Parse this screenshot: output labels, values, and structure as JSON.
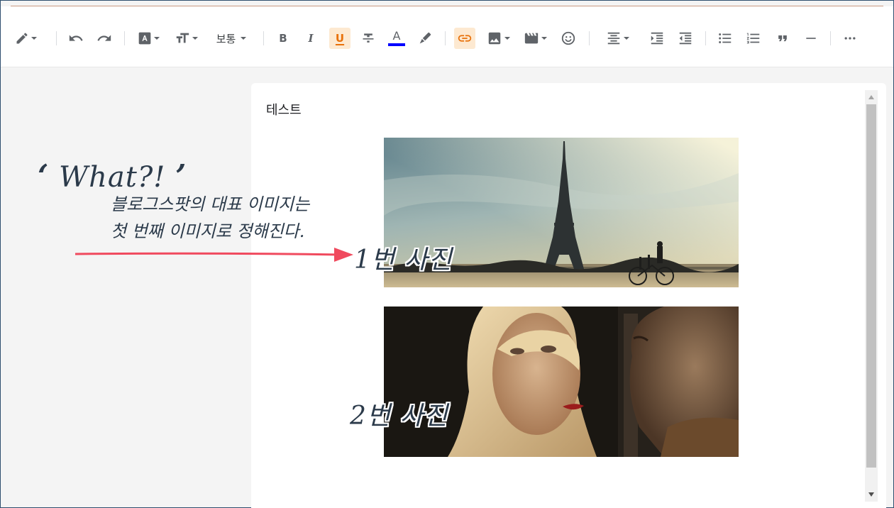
{
  "toolbar": {
    "items": [
      {
        "name": "pencil-mode",
        "icon": "pencil-icon"
      },
      {
        "name": "undo",
        "icon": "undo-icon"
      },
      {
        "name": "redo",
        "icon": "redo-icon"
      },
      {
        "name": "font-family",
        "icon": "font-a-icon"
      },
      {
        "name": "font-size",
        "icon": "text-size-icon"
      },
      {
        "name": "bold",
        "icon": "bold-icon"
      },
      {
        "name": "italic",
        "icon": "italic-icon"
      },
      {
        "name": "underline",
        "icon": "underline-icon"
      },
      {
        "name": "strikethrough",
        "icon": "strikethrough-icon"
      },
      {
        "name": "text-color",
        "icon": "text-color-icon"
      },
      {
        "name": "highlight",
        "icon": "highlighter-icon"
      },
      {
        "name": "link",
        "icon": "link-icon"
      },
      {
        "name": "insert-image",
        "icon": "image-icon"
      },
      {
        "name": "insert-video",
        "icon": "video-icon"
      },
      {
        "name": "emoji",
        "icon": "smiley-icon"
      },
      {
        "name": "align",
        "icon": "align-center-icon"
      },
      {
        "name": "indent",
        "icon": "indent-icon"
      },
      {
        "name": "outdent",
        "icon": "outdent-icon"
      },
      {
        "name": "bulleted-list",
        "icon": "bulleted-list-icon"
      },
      {
        "name": "numbered-list",
        "icon": "numbered-list-icon"
      },
      {
        "name": "quote",
        "icon": "quote-icon"
      },
      {
        "name": "horizontal-rule",
        "icon": "horizontal-rule-icon"
      },
      {
        "name": "more",
        "icon": "more-icon"
      }
    ],
    "paragraph_style": "보통",
    "bold_label": "B",
    "italic_label": "I",
    "underline_label": "U",
    "text_color_label": "A",
    "text_color": "#0000ff",
    "active_highlight": "#fde9d1",
    "accent_orange": "#e8710a"
  },
  "editor": {
    "post_title": "테스트",
    "images": [
      {
        "id": "image-1",
        "subject": "eiffel-tower-photo"
      },
      {
        "id": "image-2",
        "subject": "movie-still-photo"
      }
    ]
  },
  "annotation": {
    "what": "What?!",
    "open_quote": "‘",
    "close_quote": "’",
    "note_line1": "블로그스팟의 대표 이미지는",
    "note_line2": "첫 번째 이미지로 정해진다.",
    "label1": "1번 사진",
    "label2": "2번 사진",
    "arrow_color": "#f04a5e"
  }
}
